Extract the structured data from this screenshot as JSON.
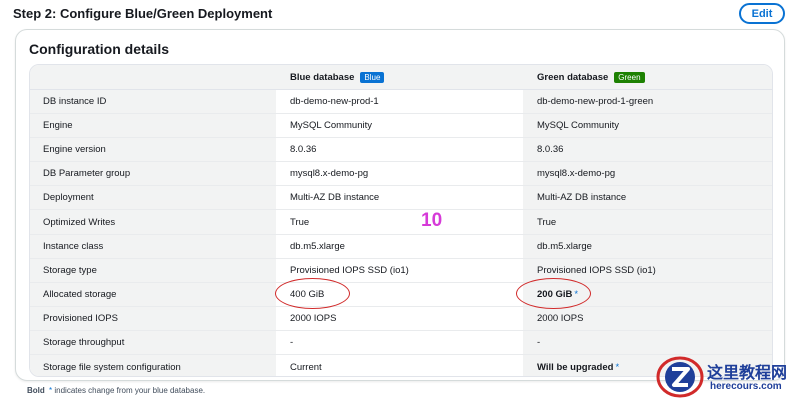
{
  "header": {
    "step_title": "Step 2: Configure Blue/Green Deployment",
    "edit_label": "Edit"
  },
  "panel": {
    "title": "Configuration details"
  },
  "table": {
    "columns": {
      "blue_header": "Blue database",
      "blue_badge": "Blue",
      "green_header": "Green database",
      "green_badge": "Green"
    },
    "rows": [
      {
        "label": "DB instance ID",
        "blue": "db-demo-new-prod-1",
        "green": "db-demo-new-prod-1-green"
      },
      {
        "label": "Engine",
        "blue": "MySQL Community",
        "green": "MySQL Community"
      },
      {
        "label": "Engine version",
        "blue": "8.0.36",
        "green": "8.0.36"
      },
      {
        "label": "DB Parameter group",
        "blue": "mysql8.x-demo-pg",
        "green": "mysql8.x-demo-pg"
      },
      {
        "label": "Deployment",
        "blue": "Multi-AZ DB instance",
        "green": "Multi-AZ DB instance"
      },
      {
        "label": "Optimized Writes",
        "blue": "True",
        "green": "True"
      },
      {
        "label": "Instance class",
        "blue": "db.m5.xlarge",
        "green": "db.m5.xlarge"
      },
      {
        "label": "Storage type",
        "blue": "Provisioned IOPS SSD (io1)",
        "green": "Provisioned IOPS SSD (io1)"
      },
      {
        "label": "Allocated storage",
        "blue": "400 GiB",
        "green": "200 GiB",
        "green_changed_marker": "*"
      },
      {
        "label": "Provisioned IOPS",
        "blue": "2000 IOPS",
        "green": "2000 IOPS"
      },
      {
        "label": "Storage throughput",
        "blue": "-",
        "green": "-"
      },
      {
        "label": "Storage file system configuration",
        "blue": "Current",
        "green": "Will be upgraded",
        "green_changed_marker": "*"
      }
    ]
  },
  "footnote": {
    "bold_word": "Bold",
    "star": "*",
    "text": " indicates change from your blue database."
  },
  "annotation": {
    "number": "10"
  },
  "watermark": {
    "title": "这里教程网",
    "subtitle": "herecours.com"
  },
  "colors": {
    "accent": "#0972d3",
    "green_badge": "#1d8102",
    "annotation": "#d63ad8",
    "ellipse": "#d12a2a"
  }
}
